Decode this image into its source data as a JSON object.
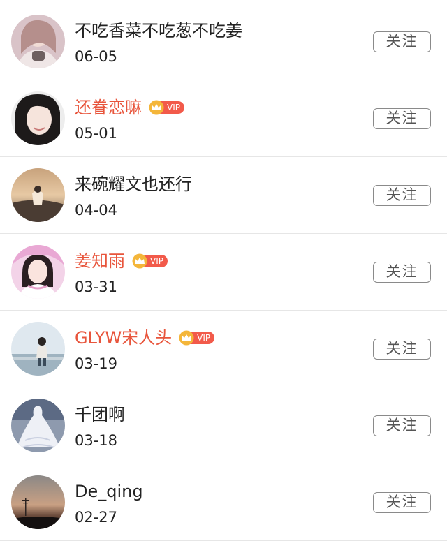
{
  "follow_list": {
    "items": [
      {
        "name": "不吃香菜不吃葱不吃姜",
        "date": "06-05",
        "vip": false,
        "button": "关注"
      },
      {
        "name": "还眷恋嘛",
        "date": "05-01",
        "vip": true,
        "vip_label": "VIP",
        "button": "关注"
      },
      {
        "name": "来碗耀文也还行",
        "date": "04-04",
        "vip": false,
        "button": "关注"
      },
      {
        "name": "姜知雨",
        "date": "03-31",
        "vip": true,
        "vip_label": "VIP",
        "button": "关注"
      },
      {
        "name": "GLYW宋人头",
        "date": "03-19",
        "vip": true,
        "vip_label": "VIP",
        "button": "关注"
      },
      {
        "name": "千团啊",
        "date": "03-18",
        "vip": false,
        "button": "关注"
      },
      {
        "name": "De_qing",
        "date": "02-27",
        "vip": false,
        "button": "关注"
      }
    ]
  },
  "colors": {
    "vip_name": "#e8553c",
    "vip_badge": "#f25a4a",
    "crown": "#f4b63a",
    "text": "#222222",
    "divider": "#e6e6e6"
  }
}
